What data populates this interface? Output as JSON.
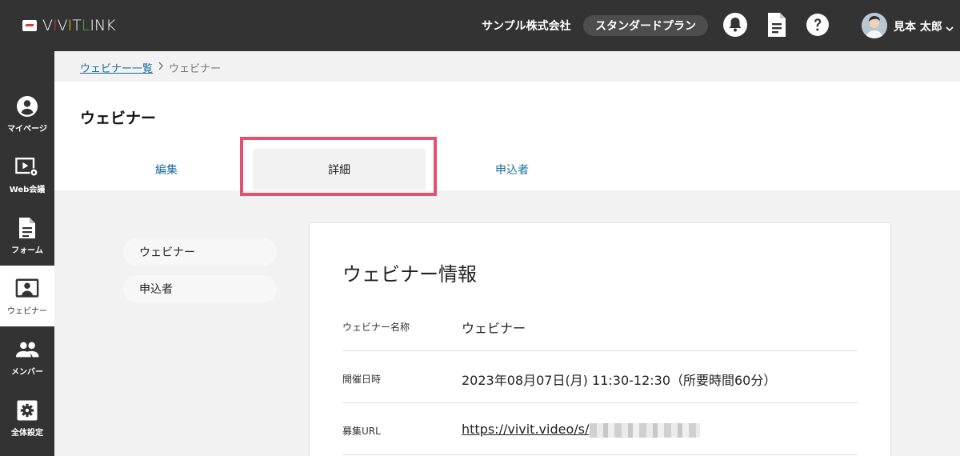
{
  "header": {
    "logo_text": "VIVITLINK",
    "company": "サンプル株式会社",
    "plan": "スタンダードプラン",
    "icons": [
      "bell-icon",
      "document-icon",
      "help-icon"
    ],
    "user_name": "見本 太郎"
  },
  "sidebar": {
    "items": [
      {
        "label": "マイページ",
        "icon": "account-circle-icon"
      },
      {
        "label": "Web会議",
        "icon": "video-settings-icon"
      },
      {
        "label": "フォーム",
        "icon": "document-icon"
      },
      {
        "label": "ウェビナー",
        "icon": "presenter-icon",
        "active": true
      },
      {
        "label": "メンバー",
        "icon": "members-icon"
      },
      {
        "label": "全体設定",
        "icon": "gear-icon"
      }
    ]
  },
  "breadcrumb": {
    "link": "ウェビナー一覧",
    "current": "ウェビナー"
  },
  "page": {
    "title": "ウェビナー",
    "tabs": [
      {
        "label": "編集"
      },
      {
        "label": "詳細",
        "active": true
      },
      {
        "label": "申込者"
      }
    ]
  },
  "submenu": {
    "items": [
      "ウェビナー",
      "申込者"
    ]
  },
  "detail": {
    "title": "ウェビナー情報",
    "rows": [
      {
        "label": "ウェビナー名称",
        "value": "ウェビナー"
      },
      {
        "label": "開催日時",
        "value": "2023年08月07日(月) 11:30-12:30（所要時間60分）"
      },
      {
        "label": "募集URL",
        "value": "https://vivit.video/s/"
      }
    ]
  },
  "colors": {
    "header_bg": "#333333",
    "highlight_border": "#e2526f",
    "link": "#1a6e9b"
  }
}
